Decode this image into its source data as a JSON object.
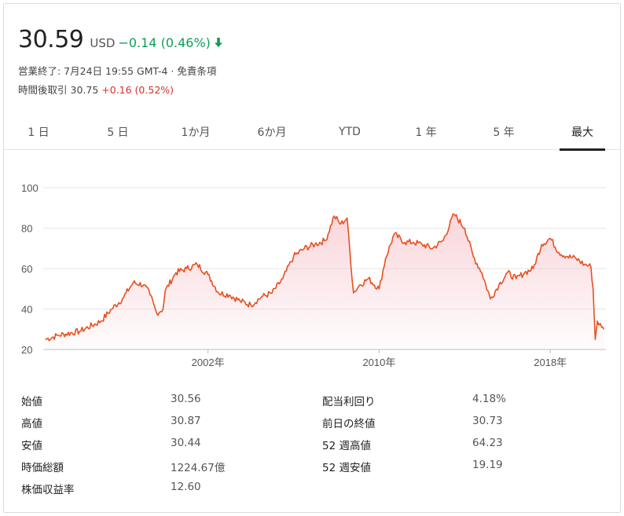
{
  "quote": {
    "price": "30.59",
    "currency": "USD",
    "change": "−0.14 (0.46%)",
    "direction_icon": "arrow-down-icon",
    "change_color": "#0f9d58"
  },
  "status_line": "営業終了: 7月24日 19:55 GMT-4 · 免責条項",
  "after_hours": {
    "label": "時間後取引",
    "price": "30.75",
    "change": "+0.16 (0.52%)",
    "change_color": "#d93025"
  },
  "tabs": [
    {
      "label": "1 日",
      "active": false
    },
    {
      "label": "5 日",
      "active": false
    },
    {
      "label": "1か月",
      "active": false
    },
    {
      "label": "6か月",
      "active": false
    },
    {
      "label": "YTD",
      "active": false
    },
    {
      "label": "1 年",
      "active": false
    },
    {
      "label": "5 年",
      "active": false
    },
    {
      "label": "最大",
      "active": true
    }
  ],
  "chart_data": {
    "type": "area",
    "series_color": "#e8501f",
    "fill_color": "#f6c8cf",
    "grid": true,
    "ylim": [
      20,
      100
    ],
    "y_ticks": [
      "20",
      "40",
      "60",
      "80",
      "100"
    ],
    "x_ticks": [
      {
        "x": 2002,
        "label": "2002年"
      },
      {
        "x": 2010,
        "label": "2010年"
      },
      {
        "x": 2018,
        "label": "2018年"
      }
    ],
    "xlim": [
      1994.3,
      2020.6
    ],
    "x": [
      1994.4,
      1995.0,
      1996.0,
      1997.0,
      1997.5,
      1998.0,
      1998.5,
      1999.0,
      1999.3,
      1999.6,
      1999.9,
      2000.0,
      2000.5,
      2001.0,
      2001.5,
      2002.0,
      2002.5,
      2003.0,
      2003.5,
      2004.0,
      2004.5,
      2005.0,
      2005.5,
      2006.0,
      2006.5,
      2007.0,
      2007.5,
      2007.9,
      2008.2,
      2008.5,
      2008.8,
      2009.1,
      2009.5,
      2010.0,
      2010.3,
      2010.7,
      2011.2,
      2011.6,
      2012.0,
      2012.5,
      2013.0,
      2013.5,
      2014.0,
      2014.4,
      2014.8,
      2015.2,
      2015.6,
      2016.0,
      2016.4,
      2016.8,
      2017.2,
      2017.6,
      2018.0,
      2018.4,
      2018.8,
      2019.2,
      2019.6,
      2019.9,
      2020.0,
      2020.1,
      2020.2,
      2020.4,
      2020.5
    ],
    "y": [
      25,
      27,
      29,
      34,
      40,
      45,
      53,
      52,
      47,
      38,
      40,
      49,
      58,
      60,
      62,
      57,
      48,
      47,
      44,
      42,
      46,
      48,
      55,
      66,
      70,
      72,
      74,
      86,
      82,
      85,
      48,
      52,
      55,
      50,
      65,
      77,
      73,
      73,
      72,
      70,
      74,
      87,
      80,
      66,
      58,
      45,
      52,
      58,
      55,
      58,
      60,
      72,
      75,
      68,
      66,
      65,
      62,
      61,
      50,
      25,
      34,
      31,
      30
    ]
  },
  "stats": {
    "left": [
      {
        "label": "始値",
        "value": "30.56"
      },
      {
        "label": "高値",
        "value": "30.87"
      },
      {
        "label": "安値",
        "value": "30.44"
      },
      {
        "label": "時価総額",
        "value": "1224.67億"
      },
      {
        "label": "株価収益率",
        "value": "12.60"
      }
    ],
    "right": [
      {
        "label": "配当利回り",
        "value": "4.18%"
      },
      {
        "label": "前日の終値",
        "value": "30.73"
      },
      {
        "label": "52 週高値",
        "value": "64.23"
      },
      {
        "label": "52 週安値",
        "value": "19.19"
      }
    ]
  }
}
